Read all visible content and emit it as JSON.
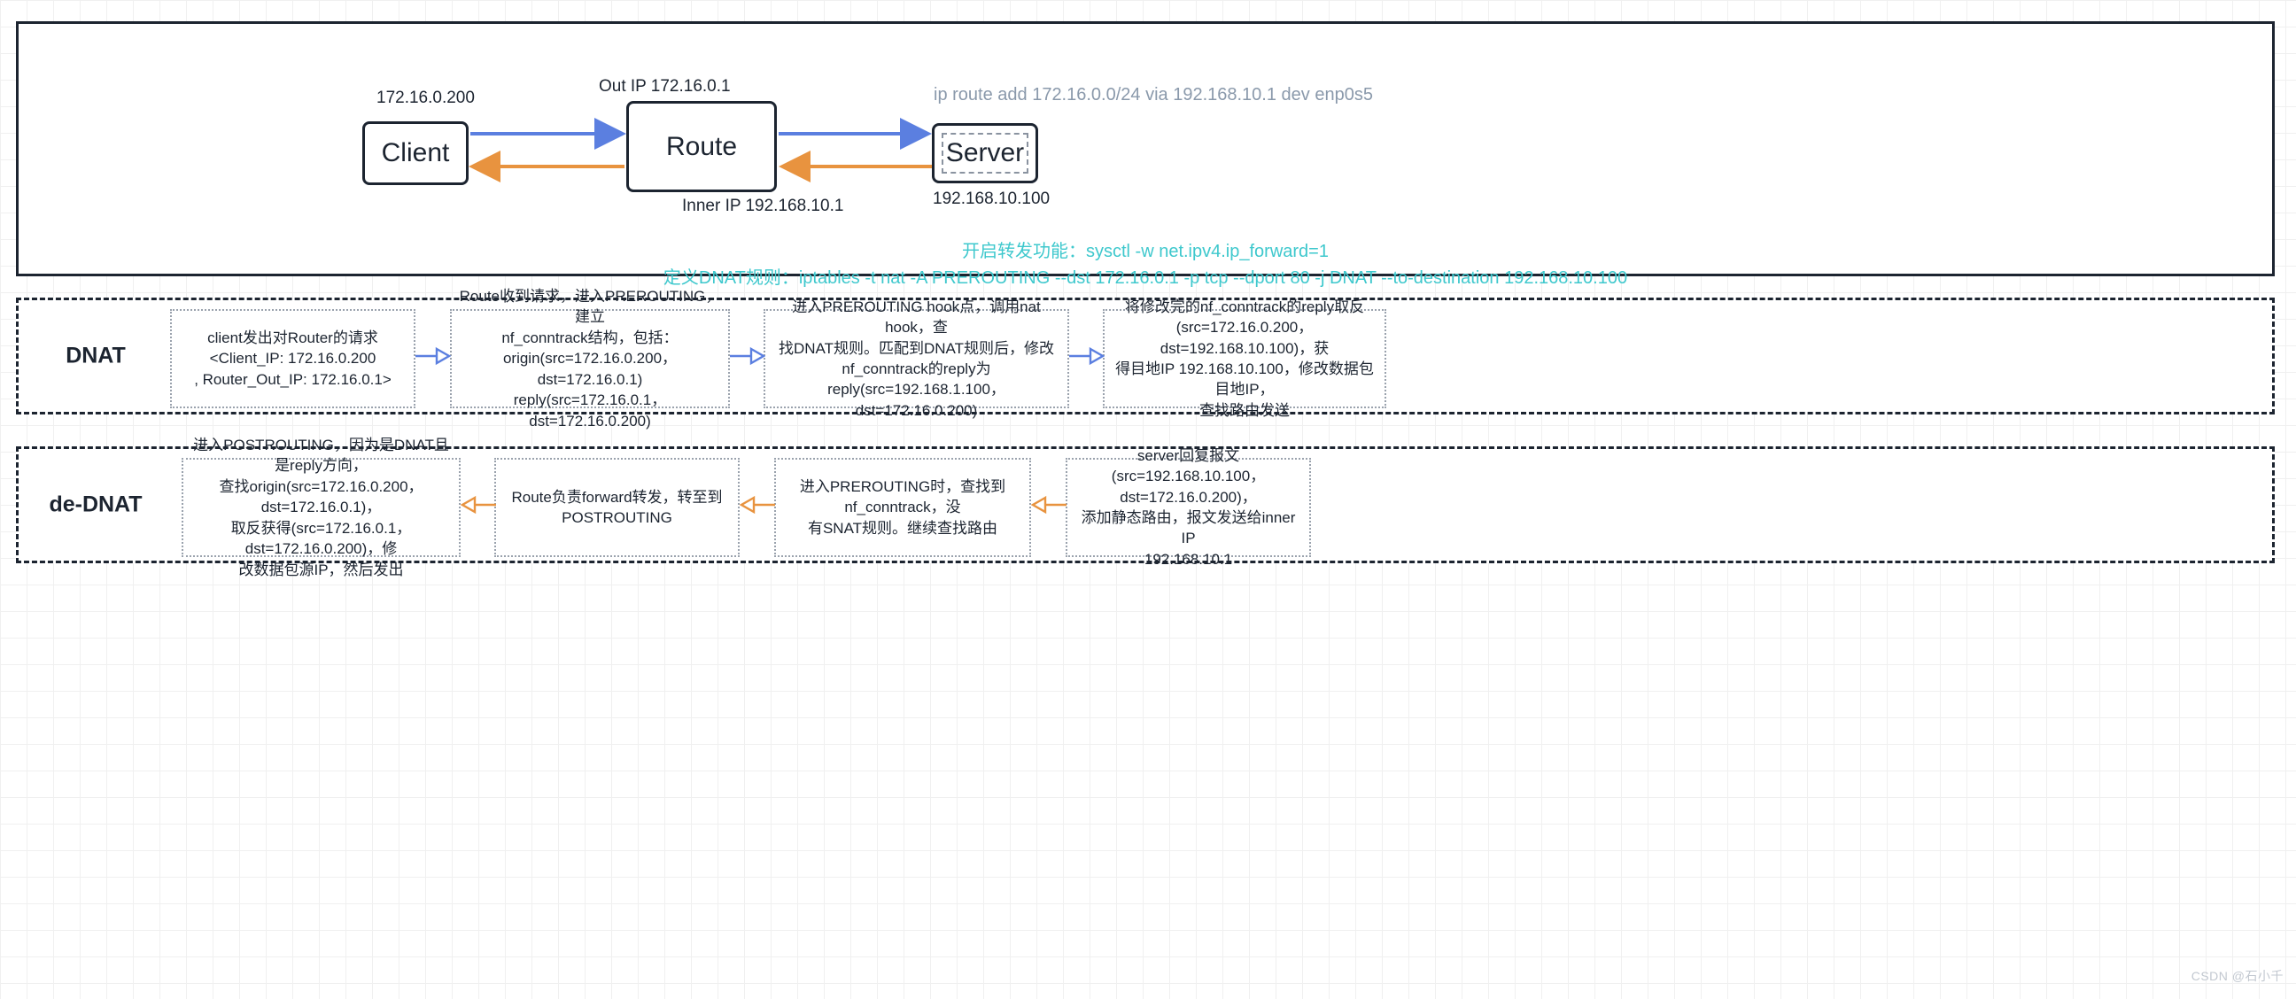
{
  "colors": {
    "border_dark": "#1c2430",
    "arrow_blue": "#5b7fe0",
    "arrow_orange": "#e8933f",
    "teal": "#3ec8cd",
    "cmd_gray": "#8a99ab",
    "box_dotted": "#9aa2ad"
  },
  "topology": {
    "nodes": {
      "client": {
        "label": "Client",
        "ip_label": "172.16.0.200"
      },
      "route": {
        "label": "Route",
        "out_ip_label": "Out IP 172.16.0.1",
        "inner_ip_label": "Inner IP  192.168.10.1"
      },
      "server": {
        "label": "Server",
        "ip_label": "192.168.10.100"
      }
    },
    "route_add_command": "ip route add 172.16.0.0/24 via 192.168.10.1 dev enp0s5",
    "config_lines": [
      "开启转发功能：sysctl -w net.ipv4.ip_forward=1",
      "定义DNAT规则：iptables -t nat -A PREROUTING --dst 172.16.0.1 -p tcp --dport 80 -j DNAT --to-destination 192.168.10.100"
    ]
  },
  "flows": [
    {
      "title": "DNAT",
      "arrow_color": "#5b7fe0",
      "direction": "right",
      "steps": [
        "client发出对Router的请求\n<Client_IP: 172.16.0.200\n, Router_Out_IP: 172.16.0.1>",
        "Route收到请求，进入PREROUTING，建立\nnf_conntrack结构，包括：\norigin(src=172.16.0.200，dst=172.16.0.1)\nreply(src=172.16.0.1，dst=172.16.0.200)",
        "进入PREROUTING hook点，调用nat hook，查\n找DNAT规则。匹配到DNAT规则后，修改\nnf_conntrack的reply为\nreply(src=192.168.1.100，dst=172.16.0.200)",
        "将修改完的nf_conntrack的reply取反\n(src=172.16.0.200，dst=192.168.10.100)，获\n得目地IP 192.168.10.100，修改数据包目地IP，\n查找路由发送"
      ]
    },
    {
      "title": "de-DNAT",
      "arrow_color": "#e8933f",
      "direction": "left",
      "steps": [
        "进入POSTROUTING，因为是DNAT且是reply方向，\n查找origin(src=172.16.0.200，dst=172.16.0.1)，\n取反获得(src=172.16.0.1，dst=172.16.0.200)，修\n改数据包源IP，然后发出",
        "Route负责forward转发，转至到\nPOSTROUTING",
        "进入PREROUTING时，查找到nf_conntrack，没\n有SNAT规则。继续查找路由",
        "server回复报文\n(src=192.168.10.100，dst=172.16.0.200)，\n添加静态路由，报文发送给inner IP\n192.168.10.1"
      ]
    }
  ],
  "watermark": "CSDN @石小千"
}
